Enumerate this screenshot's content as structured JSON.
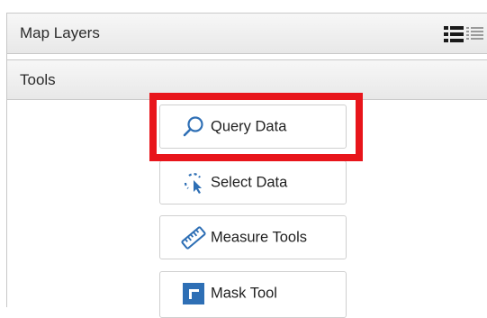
{
  "panels": {
    "map_layers": {
      "title": "Map Layers",
      "view_toggle_icon": "list-view-icon"
    },
    "tools": {
      "title": "Tools"
    }
  },
  "tools": [
    {
      "label": "Query Data",
      "icon": "search-icon",
      "highlighted": true
    },
    {
      "label": "Select Data",
      "icon": "select-data-icon",
      "highlighted": false
    },
    {
      "label": "Measure Tools",
      "icon": "ruler-icon",
      "highlighted": false
    },
    {
      "label": "Mask Tool",
      "icon": "mask-icon",
      "highlighted": false
    }
  ],
  "colors": {
    "highlight": "#e8151b",
    "icon_blue": "#2e6fb5",
    "header_bg": "#ececec"
  }
}
